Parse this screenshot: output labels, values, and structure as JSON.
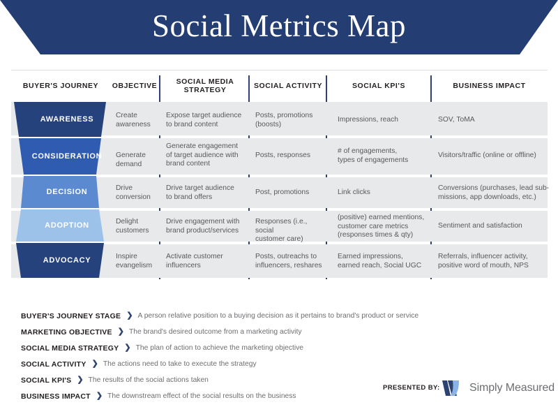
{
  "header": {
    "title": "Social Metrics Map",
    "banner_color": "#243d72"
  },
  "table": {
    "columns": [
      {
        "label": "BUYER'S JOURNEY",
        "key": "stage"
      },
      {
        "label": "OBJECTIVE",
        "key": "objective"
      },
      {
        "label": "SOCIAL MEDIA\nSTRATEGY",
        "key": "strategy"
      },
      {
        "label": "SOCIAL ACTIVITY",
        "key": "activity"
      },
      {
        "label": "SOCIAL KPI'S",
        "key": "kpi"
      },
      {
        "label": "BUSINESS IMPACT",
        "key": "impact"
      }
    ],
    "column_labels": {
      "c0": "BUYER'S JOURNEY",
      "c1": "OBJECTIVE",
      "c2_line1": "SOCIAL MEDIA",
      "c2_line2": "STRATEGY",
      "c3": "SOCIAL ACTIVITY",
      "c4": "SOCIAL KPI'S",
      "c5": "BUSINESS IMPACT"
    },
    "rows": [
      {
        "stage": "AWARENESS",
        "stage_color": "#26427c",
        "objective": "Create\nawareness",
        "strategy": "Expose target audience\nto brand content",
        "activity": "Posts, promotions\n(boosts)",
        "kpi": "Impressions, reach",
        "impact": "SOV, ToMA"
      },
      {
        "stage": "CONSIDERATION",
        "stage_color": "#2f5cb0",
        "objective": "Generate\ndemand",
        "strategy": "Generate engagement\nof target audience with\nbrand content",
        "activity": "Posts, responses",
        "kpi": "# of engagements,\ntypes of engagements",
        "impact": "Visitors/traffic (online or offline)"
      },
      {
        "stage": "DECISION",
        "stage_color": "#5b8ad0",
        "objective": "Drive\nconversion",
        "strategy": "Drive target audience\nto brand offers",
        "activity": "Post, promotions",
        "kpi": "Link clicks",
        "impact": "Conversions (purchases, lead sub-\nmissions, app downloads, etc.)"
      },
      {
        "stage": "ADOPTION",
        "stage_color": "#9dc2ea",
        "objective": "Delight\ncustomers",
        "strategy": "Drive engagement with\nbrand product/services",
        "activity": "Responses (i.e., social\ncustomer care)",
        "kpi": "(positive) earned mentions,\ncustomer care metrics\n(responses times & qty)",
        "impact": "Sentiment and satisfaction"
      },
      {
        "stage": "ADVOCACY",
        "stage_color": "#26427c",
        "objective": "Inspire\nevangelism",
        "strategy": "Activate customer\ninfluencers",
        "activity": "Posts, outreachs to\ninfluencers, reshares",
        "kpi": "Earned impressions,\nearned reach, Social UGC",
        "impact": "Referrals, influencer activity,\npositive word of mouth, NPS"
      }
    ],
    "band_color": "#e8e9eb",
    "divider_color": "#2c4372"
  },
  "legend": {
    "arrow_glyph": "❯",
    "items": [
      {
        "term": "BUYER'S JOURNEY STAGE",
        "definition": "A person relative position to a buying decision as it pertains to brand's product or service"
      },
      {
        "term": "MARKETING OBJECTIVE",
        "definition": "The brand's desired outcome from a marketing activity"
      },
      {
        "term": "SOCIAL MEDIA STRATEGY",
        "definition": "The plan of action to achieve the marketing objective"
      },
      {
        "term": "SOCIAL ACTIVITY",
        "definition": "The actions need to take to execute the strategy"
      },
      {
        "term": "SOCIAL KPI'S",
        "definition": "The results of the social actions taken"
      },
      {
        "term": "BUSINESS IMPACT",
        "definition": "The downstream effect of the social results on the business"
      }
    ]
  },
  "footer": {
    "presented_by_label": "PRESENTED BY:",
    "brand_name": "Simply Measured",
    "logo_dark": "#2c4372",
    "logo_light": "#8ab4e8"
  }
}
